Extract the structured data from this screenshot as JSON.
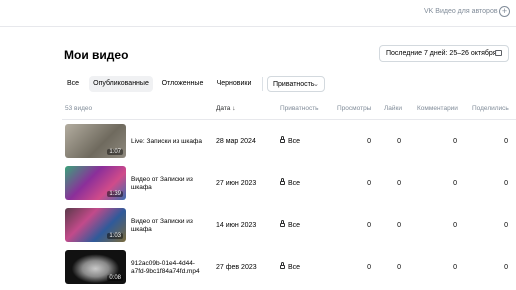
{
  "header": {
    "brand": "VK Видео для авторов",
    "plus_icon": "plus-circle-icon"
  },
  "page": {
    "title": "Мои видео",
    "date_filter": "Последние 7 дней: 25–26 октября"
  },
  "tabs": [
    {
      "label": "Все",
      "active": false
    },
    {
      "label": "Опубликованные",
      "active": true
    },
    {
      "label": "Отложенные",
      "active": false
    },
    {
      "label": "Черновики",
      "active": false
    }
  ],
  "privacy_dropdown": {
    "label": "Приватность",
    "icon": "chevron-down-icon"
  },
  "table": {
    "count_label": "53 видео",
    "headers": {
      "date": "Дата ↓",
      "privacy": "Приватность",
      "views": "Просмотры",
      "likes": "Лайки",
      "comments": "Комментарии",
      "shares": "Поделились"
    },
    "rows": [
      {
        "duration": "1:07",
        "title": "Live: Записки из шкафа",
        "date": "28 мар 2024",
        "privacy": "Все",
        "views": "0",
        "likes": "0",
        "comments": "0",
        "shares": "0",
        "thumb_color": "#8a8578"
      },
      {
        "duration": "1:39",
        "title": "Видео от Записки из шкафа",
        "date": "27 июн 2023",
        "privacy": "Все",
        "views": "0",
        "likes": "0",
        "comments": "0",
        "shares": "0",
        "thumb_color": "#6b3f7a"
      },
      {
        "duration": "1:03",
        "title": "Видео от Записки из шкафа",
        "date": "14 июн 2023",
        "privacy": "Все",
        "views": "0",
        "likes": "0",
        "comments": "0",
        "shares": "0",
        "thumb_color": "#7a4a68"
      },
      {
        "duration": "0:08",
        "title": "912ac09b-01e4-4d44-a7fd-9bc1f84a74fd.mp4",
        "date": "27 фев 2023",
        "privacy": "Все",
        "views": "0",
        "likes": "0",
        "comments": "0",
        "shares": "0",
        "thumb_color": "#1a1a1a"
      }
    ]
  }
}
